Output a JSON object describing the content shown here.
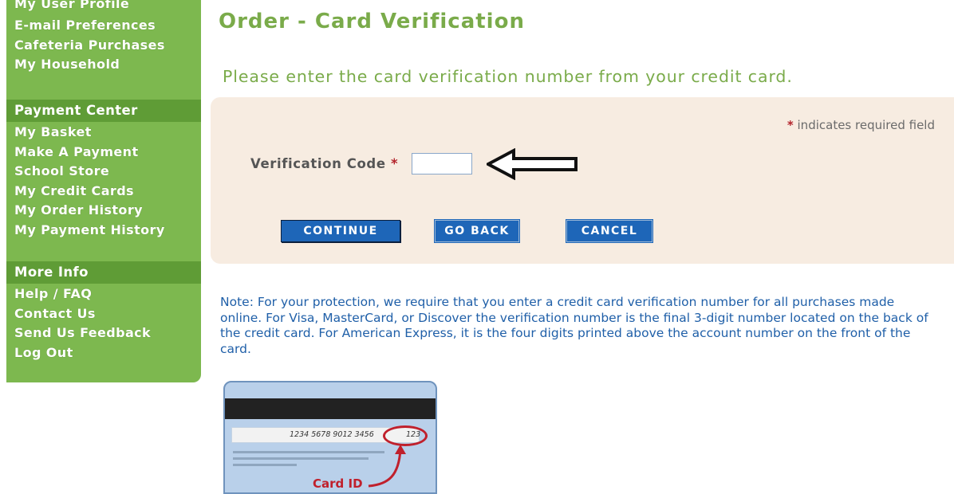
{
  "sidebar": {
    "account_items": [
      {
        "label": "My User Profile"
      },
      {
        "label": "E-mail Preferences"
      },
      {
        "label": "Cafeteria Purchases"
      },
      {
        "label": "My Household"
      }
    ],
    "payment_header": "Payment Center",
    "payment_items": [
      {
        "label": "My Basket"
      },
      {
        "label": "Make A Payment"
      },
      {
        "label": "School Store"
      },
      {
        "label": "My Credit Cards"
      },
      {
        "label": "My Order History"
      },
      {
        "label": "My Payment History"
      }
    ],
    "info_header": "More Info",
    "info_items": [
      {
        "label": "Help / FAQ"
      },
      {
        "label": "Contact Us"
      },
      {
        "label": "Send Us Feedback"
      },
      {
        "label": "Log Out"
      }
    ]
  },
  "page": {
    "title": "Order - Card Verification",
    "instruction": "Please enter the card verification number from your credit card."
  },
  "form": {
    "required_marker": "*",
    "required_note": "indicates required field",
    "verification_label": "Verification Code",
    "verification_value": "",
    "buttons": {
      "continue": "CONTINUE",
      "go_back": "GO BACK",
      "cancel": "CANCEL"
    }
  },
  "note": {
    "text": "Note: For your protection, we require that you enter a credit card verification number for all purchases made online. For Visa, MasterCard, or Discover the verification number is the final 3-digit number located on the back of the credit card. For American Express, it is the four digits printed above the account number on the front of the card."
  },
  "card_illustration": {
    "card_number": "1234 5678 9012 3456",
    "cvv": "123",
    "card_id_label": "Card ID"
  },
  "colors": {
    "sidebar_bg": "#7db84f",
    "sidebar_header_bg": "#5f9c36",
    "heading_green": "#7aab4a",
    "panel_bg": "#f7ece1",
    "button_blue": "#1e66b8",
    "note_blue": "#1f5fa8",
    "required_red": "#b3232b"
  },
  "icons": {
    "pointer_arrow": "left-arrow-icon",
    "card_pointer": "curved-arrow-icon"
  }
}
